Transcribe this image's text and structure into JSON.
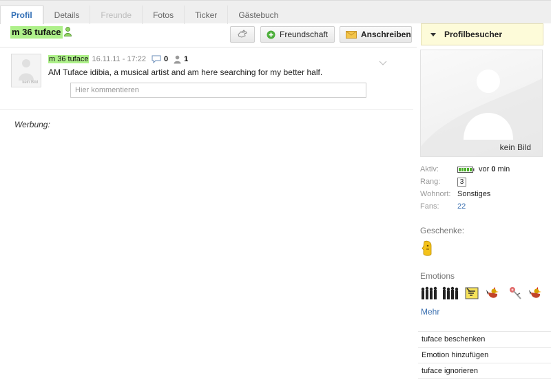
{
  "tabs": [
    {
      "label": "Profil",
      "state": "active"
    },
    {
      "label": "Details",
      "state": "normal"
    },
    {
      "label": "Freunde",
      "state": "disabled"
    },
    {
      "label": "Fotos",
      "state": "normal"
    },
    {
      "label": "Ticker",
      "state": "normal"
    },
    {
      "label": "Gästebuch",
      "state": "normal"
    }
  ],
  "header": {
    "username": "m 36 tuface",
    "buttons": {
      "friendship": "Freundschaft",
      "write": "Anschreiben"
    },
    "visitors_label": "Profilbesucher"
  },
  "post": {
    "avatar_label": "kein Bild",
    "author": "m 36 tuface",
    "date": "16.11.11 - 17:22",
    "comments_count": "0",
    "likes_count": "1",
    "text": "AM Tuface idibia, a musical artist and am here searching for my better half.",
    "comment_placeholder": "Hier kommentieren"
  },
  "ads_label": "Werbung:",
  "profile": {
    "photo_label": "kein Bild",
    "stats": [
      {
        "label": "Aktiv:",
        "value": "vor 0 min"
      },
      {
        "label": "Rang:",
        "value": "3"
      },
      {
        "label": "Wohnort:",
        "value": "Sonstiges"
      },
      {
        "label": "Fans:",
        "value": "22"
      }
    ],
    "gifts_title": "Geschenke:",
    "emotions_title": "Emotions",
    "more_label": "Mehr",
    "actions": [
      "tuface beschenken",
      "Emotion hinzufügen",
      "tuface ignorieren"
    ]
  },
  "colors": {
    "highlight_green": "#aef08a",
    "link_blue": "#3a6fb0",
    "visitors_bg": "#fdfbd9"
  }
}
